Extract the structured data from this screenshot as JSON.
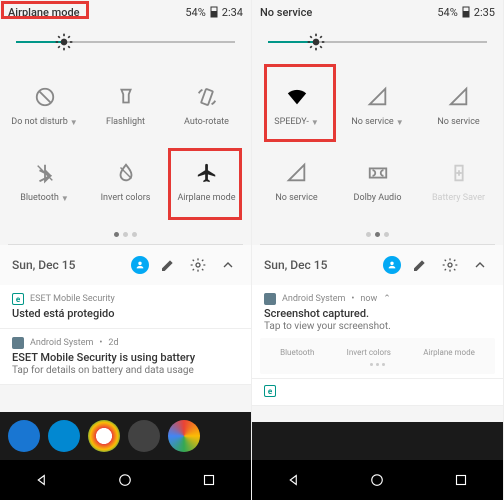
{
  "left": {
    "status_left": "Airplane mode",
    "battery": "54%",
    "time": "2:34",
    "tiles": [
      {
        "label": "Do not disturb",
        "dd": true,
        "icon": "dnd"
      },
      {
        "label": "Flashlight",
        "icon": "flash"
      },
      {
        "label": "Auto-rotate",
        "icon": "rotate"
      },
      {
        "label": "Bluetooth",
        "dd": true,
        "icon": "bt"
      },
      {
        "label": "Invert colors",
        "icon": "invert"
      },
      {
        "label": "Airplane mode",
        "icon": "plane",
        "dark": true
      }
    ],
    "date": "Sun, Dec 15",
    "notif1": {
      "app": "ESET Mobile Security",
      "title": "Usted está protegido"
    },
    "notif2": {
      "app": "Android System",
      "age": "2d",
      "title": "ESET Mobile Security is using battery",
      "body": "Tap for details on battery and data usage"
    }
  },
  "right": {
    "status_left": "No service",
    "battery": "54%",
    "time": "2:35",
    "tiles": [
      {
        "label": "SPEEDY-",
        "dd": true,
        "icon": "wifi",
        "dark": true
      },
      {
        "label": "No service",
        "dd": true,
        "icon": "signal"
      },
      {
        "label": "No service",
        "icon": "signal"
      },
      {
        "label": "No service",
        "icon": "signal"
      },
      {
        "label": "Dolby Audio",
        "icon": "dolby"
      },
      {
        "label": "Battery Saver",
        "icon": "battery",
        "dim": true
      }
    ],
    "date": "Sun, Dec 15",
    "notif1": {
      "app": "Android System",
      "age": "now",
      "title": "Screenshot captured.",
      "body": "Tap to view your screenshot."
    },
    "mini": [
      "Bluetooth",
      "Invert colors",
      "Airplane mode"
    ]
  }
}
